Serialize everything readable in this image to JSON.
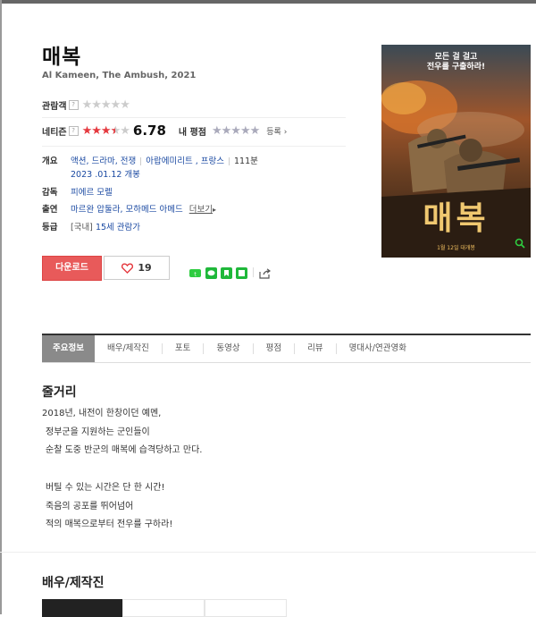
{
  "movie": {
    "title": "매복",
    "subtitle": "Al Kameen, The Ambush, 2021"
  },
  "ratings": {
    "audience_label": "관람객",
    "netizen_label": "네티즌",
    "netizen_score": "6.78",
    "netizen_score_value": 6.78,
    "my_rating_label": "내 평점",
    "register_label": "등록",
    "help_glyph": "?"
  },
  "info": {
    "overview_label": "개요",
    "genres": "액션, 드라마, 전쟁",
    "countries": "아랍에미리트 , 프랑스",
    "runtime": "111분",
    "release": "2023 .01.12 개봉",
    "director_label": "감독",
    "director": "피에르 모렐",
    "cast_label": "출연",
    "cast": "마르완 압둘라, 모하메드 아메드",
    "more_label": "더보기",
    "grade_label": "등급",
    "grade_prefix": "[국내]",
    "grade": "15세 관람가"
  },
  "actions": {
    "download_label": "다운로드",
    "like_count": "19"
  },
  "tabs": [
    "주요정보",
    "배우/제작진",
    "포토",
    "동영상",
    "평점",
    "리뷰",
    "명대사/연관영화"
  ],
  "synopsis": {
    "heading": "줄거리",
    "lines": [
      "2018년, 내전이 한창이던 예멘,",
      "정부군을 지원하는 군인들이",
      "순찰 도중 반군의 매복에 습격당하고 만다.",
      "",
      "버틸 수 있는 시간은 단 한 시간!",
      "죽음의 공포를 뛰어넘어",
      "적의 매복으로부터 전우를 구하라!"
    ]
  },
  "cast_section": {
    "heading": "배우/제작진"
  },
  "poster": {
    "tagline_1": "모든 걸 걸고",
    "tagline_2": "전우를 구출하라!",
    "title_art": "매복",
    "release_note": "1월 12일 대개봉"
  }
}
